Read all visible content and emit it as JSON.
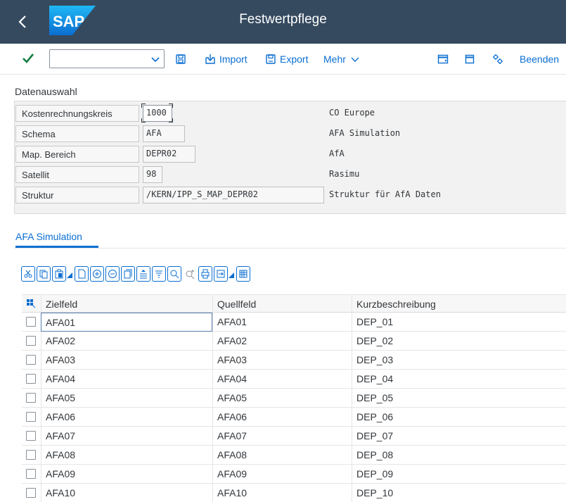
{
  "header": {
    "title": "Festwertpflege"
  },
  "toolbar": {
    "command_value": "",
    "import_label": "Import",
    "export_label": "Export",
    "more_label": "Mehr",
    "exit_label": "Beenden"
  },
  "selection": {
    "title": "Datenauswahl",
    "rows": [
      {
        "label": "Kostenrechnungskreis",
        "value": "1000",
        "description": "CO Europe"
      },
      {
        "label": "Schema",
        "value": "AFA",
        "description": "AFA Simulation"
      },
      {
        "label": "Map. Bereich",
        "value": "DEPR02",
        "description": "AfA"
      },
      {
        "label": "Satellit",
        "value": "98",
        "description": "Rasimu"
      },
      {
        "label": "Struktur",
        "value": "/KERN/IPP_S_MAP_DEPR02",
        "description": "Struktur für AfA Daten"
      }
    ]
  },
  "tab": {
    "label": "AFA Simulation"
  },
  "table": {
    "columns": [
      "Zielfeld",
      "Quellfeld",
      "Kurzbeschreibung"
    ],
    "rows": [
      [
        "AFA01",
        "AFA01",
        "DEP_01"
      ],
      [
        "AFA02",
        "AFA02",
        "DEP_02"
      ],
      [
        "AFA03",
        "AFA03",
        "DEP_03"
      ],
      [
        "AFA04",
        "AFA04",
        "DEP_04"
      ],
      [
        "AFA05",
        "AFA05",
        "DEP_05"
      ],
      [
        "AFA06",
        "AFA06",
        "DEP_06"
      ],
      [
        "AFA07",
        "AFA07",
        "DEP_07"
      ],
      [
        "AFA08",
        "AFA08",
        "DEP_08"
      ],
      [
        "AFA09",
        "AFA09",
        "DEP_09"
      ],
      [
        "AFA10",
        "AFA10",
        "DEP_10"
      ]
    ]
  },
  "colors": {
    "shell": "#354a5f",
    "accent": "#0a6ed1",
    "check": "#107e3e"
  }
}
